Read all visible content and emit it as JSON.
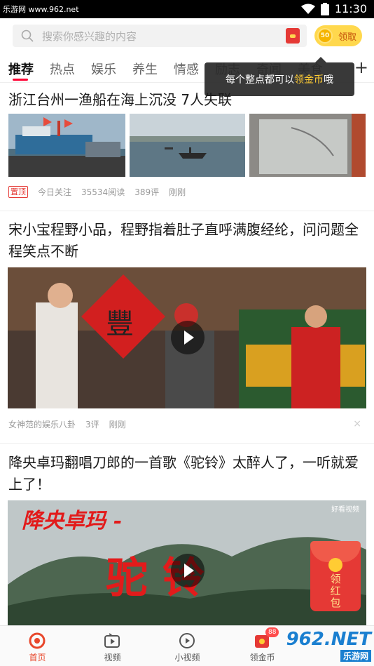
{
  "status_bar": {
    "watermark": "乐游网 www.962.net",
    "time": "11:30"
  },
  "search": {
    "placeholder": "搜索你感兴趣的内容"
  },
  "coin_button": {
    "coin_value": "50",
    "label": "领取"
  },
  "tabs": [
    "推荐",
    "热点",
    "娱乐",
    "养生",
    "情感",
    "励志",
    "奇闻",
    "美食"
  ],
  "tab_plus": "+",
  "tooltip": {
    "before": "每个整点都可以",
    "highlight": "领金币",
    "after": "哦"
  },
  "articles": [
    {
      "title": "浙江台州一渔船在海上沉没 7人失联",
      "pin_label": "置顶",
      "source": "今日关注",
      "reads": "35534阅读",
      "comments": "389评",
      "time": "刚刚"
    },
    {
      "title": "宋小宝程野小品，程野指着肚子直呼满腹经纶，问问题全程笑点不断",
      "source": "女神范的娱乐八卦",
      "comments": "3评",
      "time": "刚刚",
      "fu_char": "豐",
      "close": "×"
    },
    {
      "title": "降央卓玛翻唱刀郎的一首歌《驼铃》太醉人了，一听就爱上了！",
      "overlay_top": "降央卓玛 -",
      "overlay_main": "驼 铃",
      "red_packet_text": "领红包",
      "watermark_small": "好看视频"
    }
  ],
  "bottom_nav": [
    {
      "label": "首页",
      "icon": "home-icon",
      "active": true
    },
    {
      "label": "视频",
      "icon": "video-icon",
      "active": false
    },
    {
      "label": "小视频",
      "icon": "short-video-icon",
      "active": false
    },
    {
      "label": "领金币",
      "icon": "gold-coin-icon",
      "active": false,
      "badge": "88"
    }
  ],
  "watermark_962": {
    "main": "962.NET",
    "sub": "乐游网"
  },
  "colors": {
    "accent": "#e8472b",
    "coin_yellow": "#ffd84d",
    "highlight": "#ffcc33"
  }
}
